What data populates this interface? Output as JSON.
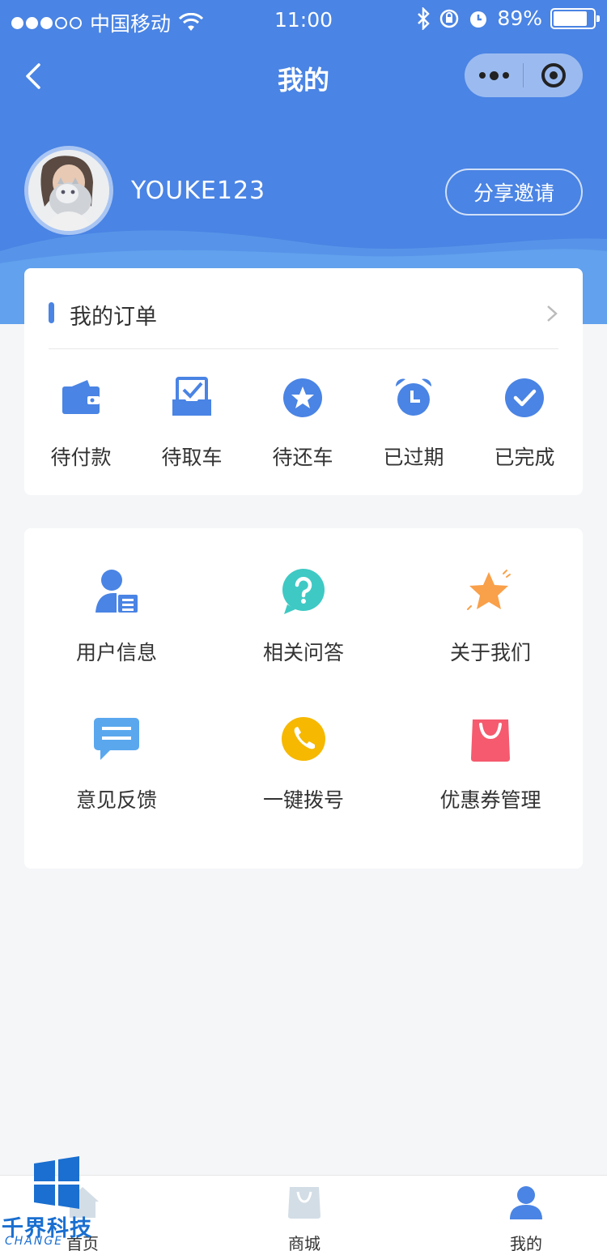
{
  "status_bar": {
    "carrier": "中国移动",
    "time": "11:00",
    "battery": "89%"
  },
  "nav": {
    "title": "我的"
  },
  "profile": {
    "username": "YOUKE123",
    "share_label": "分享邀请"
  },
  "orders": {
    "title": "我的订单",
    "items": [
      {
        "label": "待付款",
        "icon": "wallet-icon"
      },
      {
        "label": "待取车",
        "icon": "inbox-check-icon"
      },
      {
        "label": "待还车",
        "icon": "star-circle-icon"
      },
      {
        "label": "已过期",
        "icon": "alarm-clock-icon"
      },
      {
        "label": "已完成",
        "icon": "check-circle-icon"
      }
    ]
  },
  "menu": {
    "items": [
      {
        "label": "用户信息",
        "icon": "user-info-icon"
      },
      {
        "label": "相关问答",
        "icon": "question-icon"
      },
      {
        "label": "关于我们",
        "icon": "star-icon"
      },
      {
        "label": "意见反馈",
        "icon": "message-icon"
      },
      {
        "label": "一键拨号",
        "icon": "phone-icon"
      },
      {
        "label": "优惠券管理",
        "icon": "shopping-bag-icon"
      }
    ]
  },
  "tabbar": {
    "items": [
      {
        "label": "首页",
        "icon": "home-icon"
      },
      {
        "label": "商城",
        "icon": "shop-bag-icon"
      },
      {
        "label": "我的",
        "icon": "user-icon"
      }
    ]
  },
  "watermark": {
    "title": "千界科技",
    "subtitle": "CHANGE"
  },
  "colors": {
    "primary": "#4a84e4",
    "teal": "#3ec9c4",
    "orange": "#f9a04a",
    "yellow": "#f6b800",
    "pink": "#f55a6e",
    "light_blue": "#5aa7ee"
  }
}
